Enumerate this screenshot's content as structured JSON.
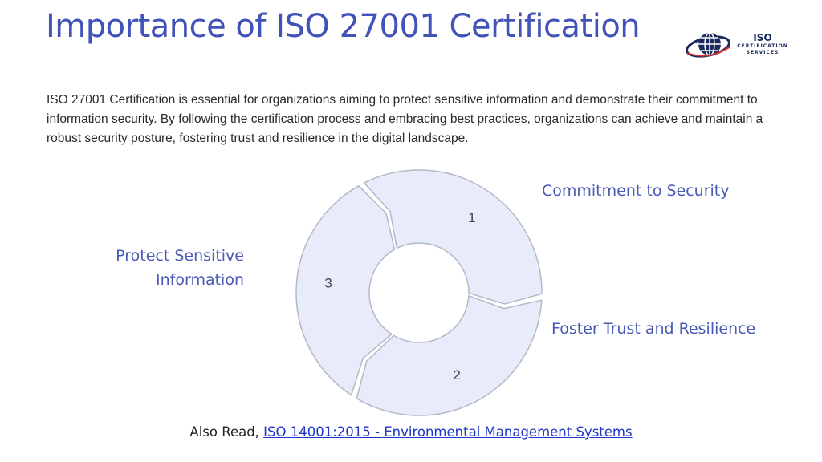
{
  "header": {
    "title": "Importance of ISO 27001 Certification"
  },
  "logo": {
    "line1": "ISO",
    "line2": "CERTIFICATION",
    "line3": "SERVICES",
    "icon": "globe-icon"
  },
  "description": "ISO 27001 Certification is essential for organizations aiming to protect sensitive information and demonstrate their commitment to information security. By following the certification process and embracing best practices, organizations can achieve and maintain a robust security posture, fostering trust and resilience in the digital landscape.",
  "cycle": {
    "segments": [
      {
        "number": "1",
        "label": "Protect Sensitive Information"
      },
      {
        "number": "2",
        "label": "Commitment to Security"
      },
      {
        "number": "3",
        "label": "Foster Trust and Resilience"
      }
    ]
  },
  "footer": {
    "prefix": "Also Read,",
    "link_text": "ISO 14001:2015 - Environmental Management Systems"
  },
  "colors": {
    "title": "#4152b8",
    "segment_fill": "#e8ebfa",
    "segment_stroke": "#b4b8c6",
    "link": "#1d35c9"
  }
}
